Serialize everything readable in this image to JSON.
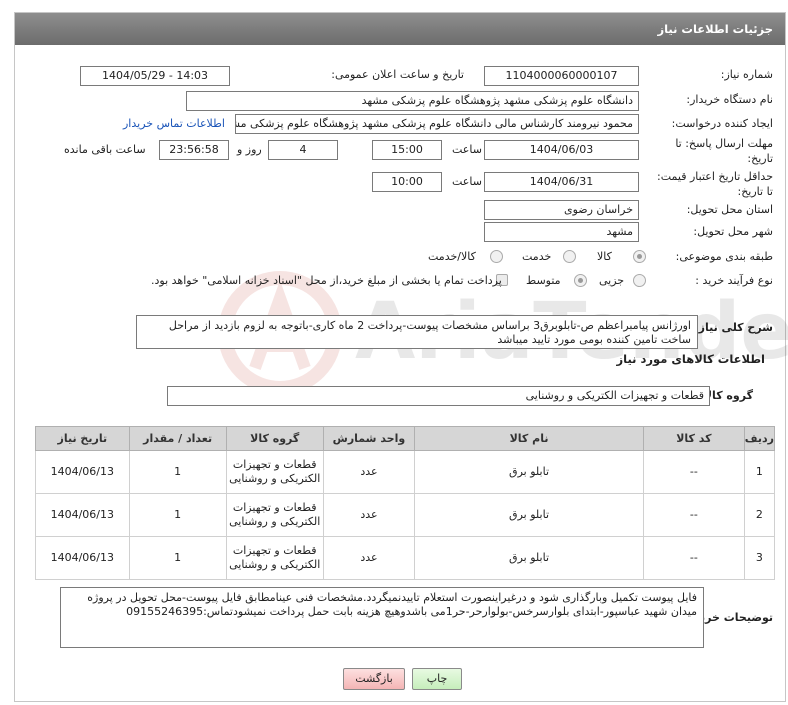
{
  "window": {
    "title": "جزئیات اطلاعات نیاز"
  },
  "form": {
    "need_number_label": "شماره نیاز:",
    "need_number": "1104000060000107",
    "announce_label": "تاریخ و ساعت اعلان عمومی:",
    "announce_value": "1404/05/29 - 14:03",
    "buyer_label": "نام دستگاه خریدار:",
    "buyer_value": "دانشگاه علوم پزشکی مشهد   پژوهشگاه علوم پزشکی مشهد",
    "creator_label": "ایجاد کننده درخواست:",
    "creator_value": "محمود نیرومند کارشناس مالی دانشگاه علوم پزشکی مشهد   پژوهشگاه علوم پزشکی مشهد",
    "contact_link": "اطلاعات تماس خریدار",
    "deadline_label_1": "مهلت ارسال پاسخ: تا",
    "deadline_label_2": "تاریخ:",
    "deadline_date": "1404/06/03",
    "time_label": "ساعت",
    "deadline_time": "15:00",
    "days_value": "4",
    "days_label": "روز و",
    "remaining_time": "23:56:58",
    "remaining_label": "ساعت باقی مانده",
    "validity_label_1": "حداقل تاریخ اعتبار قیمت:",
    "validity_label_2": "تا تاریخ:",
    "validity_date": "1404/06/31",
    "validity_time": "10:00",
    "province_label": "استان محل تحویل:",
    "province_value": "خراسان رضوی",
    "city_label": "شهر محل تحویل:",
    "city_value": "مشهد",
    "category_label": "طبقه بندی موضوعی:",
    "category_options": [
      "کالا",
      "خدمت",
      "کالا/خدمت"
    ],
    "category_selected": "کالا",
    "process_label": "نوع فرآیند خرید :",
    "process_options": [
      "جزیی",
      "متوسط"
    ],
    "payment_note": "پرداخت تمام یا بخشی از مبلغ خرید،از محل \"اسناد خزانه اسلامی\" خواهد بود.",
    "desc_label": "شرح کلی نیاز:",
    "desc_value": "اورژانس پیامبراعظم ص-تابلوبرق3 براساس مشخصات پیوست-پرداخت 2 ماه کاری-باتوجه به لزوم بازدید از مراحل ساخت تامین کننده بومی مورد تایید میباشد"
  },
  "goods": {
    "section_title": "اطلاعات کالاهای مورد نیاز",
    "group_label": "گروه کالا:",
    "group_value": "قطعات و تجهیزات الکتریکی و روشنایی",
    "columns": [
      "ردیف",
      "کد کالا",
      "نام کالا",
      "واحد شمارش",
      "گروه کالا",
      "تعداد / مقدار",
      "تاریخ نیاز"
    ],
    "rows": [
      {
        "idx": "1",
        "code": "--",
        "name": "تابلو برق",
        "unit": "عدد",
        "group": "قطعات و تجهیزات الکتریکی و روشنایی",
        "qty": "1",
        "date": "1404/06/13"
      },
      {
        "idx": "2",
        "code": "--",
        "name": "تابلو برق",
        "unit": "عدد",
        "group": "قطعات و تجهیزات الکتریکی و روشنایی",
        "qty": "1",
        "date": "1404/06/13"
      },
      {
        "idx": "3",
        "code": "--",
        "name": "تابلو برق",
        "unit": "عدد",
        "group": "قطعات و تجهیزات الکتریکی و روشنایی",
        "qty": "1",
        "date": "1404/06/13"
      }
    ]
  },
  "notes": {
    "label": "توضیحات خریدار:",
    "value": "فایل پیوست تکمیل وبارگذاری شود و درغیراینصورت استعلام تاییدنمیگردد.مشخصات فنی عینامطابق فایل پیوست-محل تحویل در پروژه میدان شهید عباسپور-ابتدای بلوارسرخس-بولوارحر-حر1می باشدوهیچ هزینه بابت حمل  پرداخت نمیشودتماس:09155246395"
  },
  "buttons": {
    "print": "چاپ",
    "back": "بازگشت"
  },
  "colors": {
    "title_bar": "#7d7d7d",
    "link": "#1a54b8",
    "back_button": "#f8caca",
    "print_button": "#d9f5d2"
  }
}
